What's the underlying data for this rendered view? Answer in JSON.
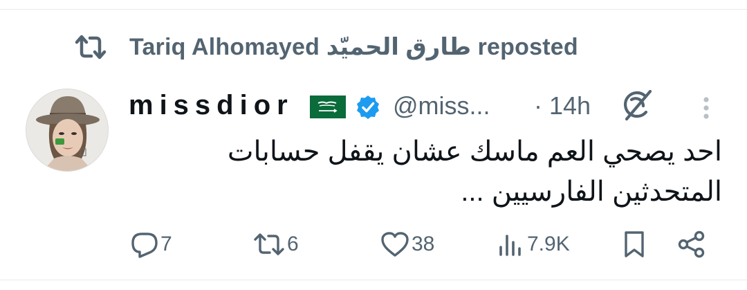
{
  "repost": {
    "text": "Tariq Alhomayed طارق الحميّد reposted"
  },
  "tweet": {
    "display_name": "missdior",
    "handle": "@miss...",
    "time": "· 14h",
    "text": "احد يصحي العم ماسك عشان يقفل  حسابات المتحدثين الفارسيين ..."
  },
  "actions": {
    "replies": "7",
    "reposts": "6",
    "likes": "38",
    "views": "7.9K"
  },
  "colors": {
    "secondary_text": "#536471",
    "verified": "#1d9bf0",
    "flag_green": "#0a6b3b"
  },
  "icons": {
    "repost": "repost-icon",
    "verified": "verified-badge-icon",
    "grok": "grok-icon",
    "more": "more-dots-icon",
    "reply": "reply-icon",
    "like": "heart-icon",
    "views": "views-icon",
    "bookmark": "bookmark-icon",
    "share": "share-icon"
  }
}
